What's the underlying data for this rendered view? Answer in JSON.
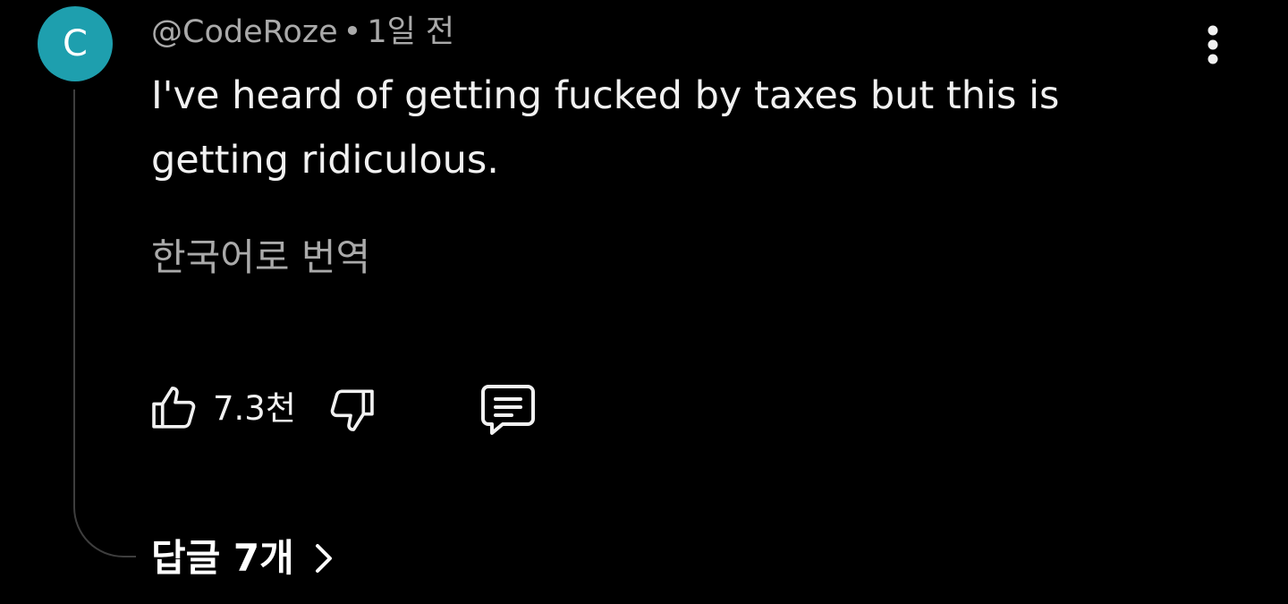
{
  "comment": {
    "avatar_initial": "C",
    "avatar_color": "#1e9fae",
    "author": "@CodeRoze",
    "separator": "•",
    "time": "1일 전",
    "text": "I've heard of getting fucked by taxes but this is getting ridiculous.",
    "translate_label": "한국어로 번역",
    "more_icon": "more-vertical-icon",
    "actions": {
      "like_icon": "thumbs-up-icon",
      "like_count": "7.3천",
      "dislike_icon": "thumbs-down-icon",
      "reply_icon": "comment-icon"
    },
    "replies_label": "답글 7개",
    "replies_icon": "chevron-right-icon"
  }
}
